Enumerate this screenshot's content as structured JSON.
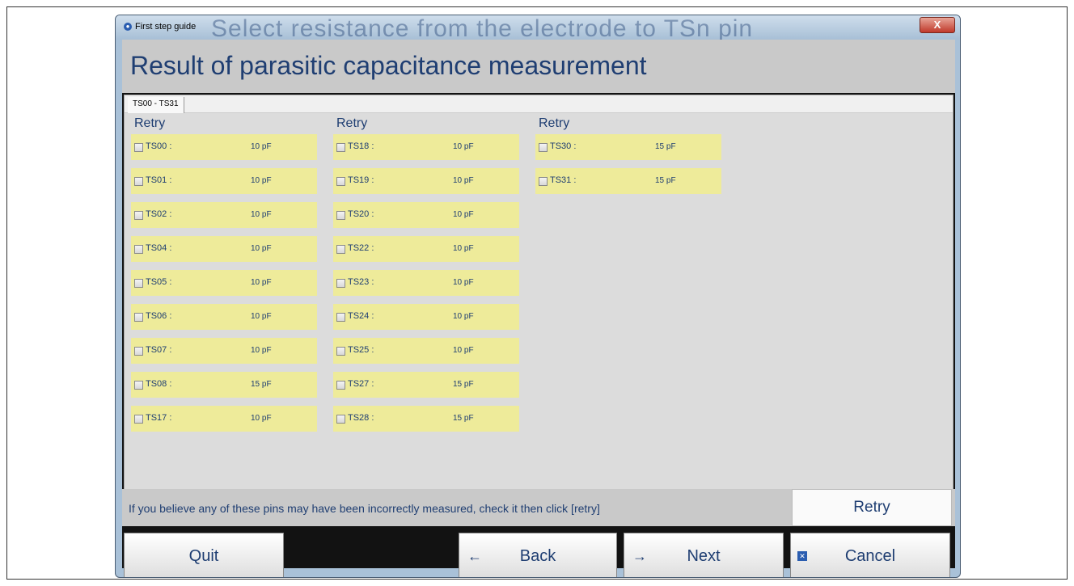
{
  "window": {
    "title": "First step guide",
    "ghost_text": "Select resistance from the electrode to TSn pin",
    "close_label": "X"
  },
  "header": {
    "title": "Result of parasitic capacitance measurement"
  },
  "tabs": [
    {
      "label": "TS00 - TS31"
    }
  ],
  "columns": [
    {
      "retry_label": "Retry",
      "pins": [
        {
          "name": "TS00 :",
          "value": "10 pF"
        },
        {
          "name": "TS01 :",
          "value": "10 pF"
        },
        {
          "name": "TS02 :",
          "value": "10 pF"
        },
        {
          "name": "TS04 :",
          "value": "10 pF"
        },
        {
          "name": "TS05 :",
          "value": "10 pF"
        },
        {
          "name": "TS06 :",
          "value": "10 pF"
        },
        {
          "name": "TS07 :",
          "value": "10 pF"
        },
        {
          "name": "TS08 :",
          "value": "15 pF"
        },
        {
          "name": "TS17 :",
          "value": "10 pF"
        }
      ]
    },
    {
      "retry_label": "Retry",
      "pins": [
        {
          "name": "TS18 :",
          "value": "10 pF"
        },
        {
          "name": "TS19 :",
          "value": "10 pF"
        },
        {
          "name": "TS20 :",
          "value": "10 pF"
        },
        {
          "name": "TS22 :",
          "value": "10 pF"
        },
        {
          "name": "TS23 :",
          "value": "10 pF"
        },
        {
          "name": "TS24 :",
          "value": "10 pF"
        },
        {
          "name": "TS25 :",
          "value": "10 pF"
        },
        {
          "name": "TS27 :",
          "value": "15 pF"
        },
        {
          "name": "TS28 :",
          "value": "15 pF"
        }
      ]
    },
    {
      "retry_label": "Retry",
      "pins": [
        {
          "name": "TS30 :",
          "value": "15 pF"
        },
        {
          "name": "TS31 :",
          "value": "15 pF"
        }
      ]
    }
  ],
  "hint": "If you believe any of these pins may have been incorrectly measured, check it then click [retry]",
  "buttons": {
    "retry": "Retry",
    "quit": "Quit",
    "back": "Back",
    "next": "Next",
    "cancel": "Cancel"
  },
  "icons": {
    "back": "arrow-left-icon",
    "next": "arrow-right-icon",
    "cancel": "cancel-icon"
  },
  "colors": {
    "accent_text": "#1f3e72",
    "pin_bg": "#eeeb9a",
    "header_bg": "#c9c9c9"
  }
}
